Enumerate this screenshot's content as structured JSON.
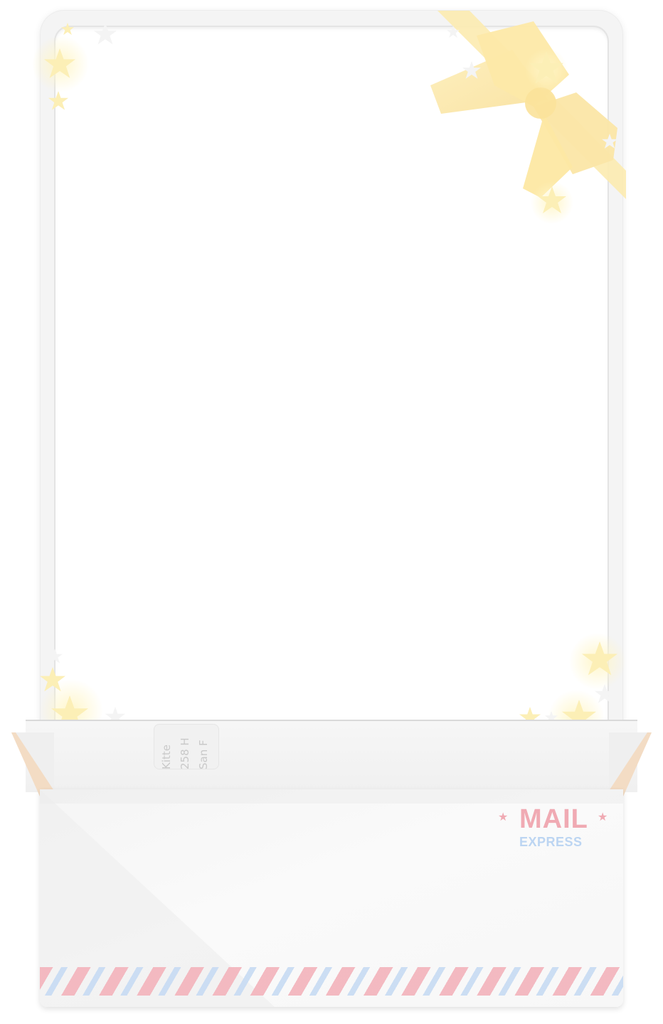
{
  "envelope": {
    "title": "MAIL",
    "subtitle": "EXPRESS",
    "star_glyph": "★",
    "address_lines": [
      "Kitte",
      "258 H",
      "San F"
    ]
  },
  "colors": {
    "mail_pink": "#f0aab3",
    "express_blue": "#bcd5f2",
    "bow_yellow": "#fbe6a6",
    "stripe_pink": "#f3b6be",
    "stripe_blue": "#c9dcf3"
  }
}
